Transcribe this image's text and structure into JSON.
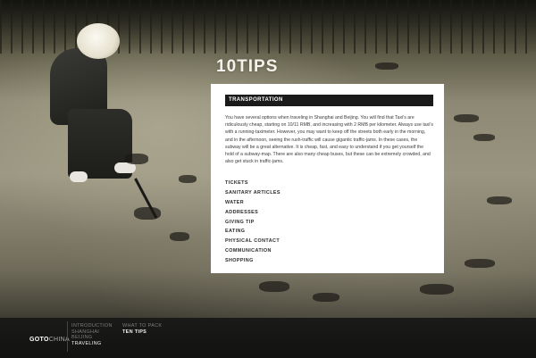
{
  "page": {
    "title": "10TIPS"
  },
  "panel": {
    "header": "TRANSPORTATION",
    "body": "You have several options when traveling in Shanghai and Beijing. You will find that Taxi's are ridiculously cheap, starting on 10/11 RMB, and increasing with 2 RMB per kilometer. Always use taxi's with a running-taximeter. However, you may want to keep off the streets both early in the morning, and in the afternoon, seeing the rush-traffic will cause gigantic traffic-jams. In these cases, the subway will be a great alternative. It is cheap, fast, and easy to understand if you get yourself the hold of a subway-map. There are also many cheap buses, but these can be extremely crowded, and also get stuck in traffic-jams.",
    "tips": [
      "TICKETS",
      "SANITARY ARTICLES",
      "WATER",
      "ADDRESSES",
      "GIVING TIP",
      "EATING",
      "PHYSICAL CONTACT",
      "COMMUNICATION",
      "SHOPPING"
    ]
  },
  "footer": {
    "brand_main": "GOTO",
    "brand_accent": "CHINA",
    "nav_primary": [
      "INTRODUCTION",
      "SHANGHAI",
      "BEIJING",
      "TRAVELING"
    ],
    "nav_primary_active": "TRAVELING",
    "nav_secondary": [
      "WHAT TO PACK",
      "TEN TIPS"
    ],
    "nav_secondary_active": "TEN TIPS"
  }
}
